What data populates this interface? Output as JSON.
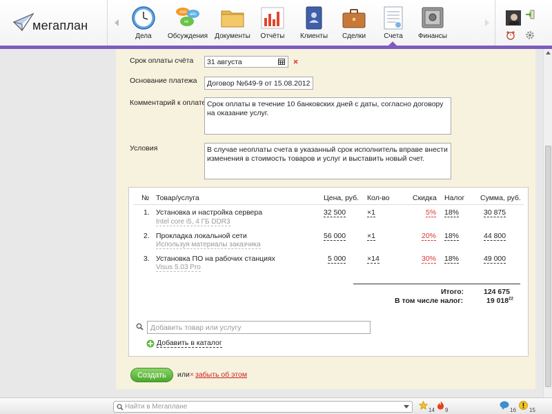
{
  "app": {
    "logo_text": "мегаплан"
  },
  "nav": [
    {
      "key": "tasks",
      "label": "Дела",
      "icon": "clock-icon"
    },
    {
      "key": "discussions",
      "label": "Обсуждения",
      "icon": "speech-bubbles-icon",
      "bubble_texts": [
        "лол",
        "айс",
        "ок"
      ]
    },
    {
      "key": "documents",
      "label": "Документы",
      "icon": "folder-icon"
    },
    {
      "key": "reports",
      "label": "Отчёты",
      "icon": "bar-chart-icon"
    },
    {
      "key": "clients",
      "label": "Клиенты",
      "icon": "contacts-book-icon"
    },
    {
      "key": "deals",
      "label": "Сделки",
      "icon": "briefcase-icon"
    },
    {
      "key": "invoices",
      "label": "Счета",
      "icon": "invoice-icon",
      "active": true
    },
    {
      "key": "finances",
      "label": "Финансы",
      "icon": "safe-icon"
    }
  ],
  "form": {
    "due_date": {
      "label": "Срок оплаты счёта",
      "value": "31 августа"
    },
    "basis": {
      "label": "Основание платежа",
      "value": "Договор №649-9 от 15.08.2012"
    },
    "comment": {
      "label": "Комментарий к оплате",
      "value": "Срок оплаты в течение 10 банковских дней с даты, согласно договору на оказание услуг."
    },
    "terms": {
      "label": "Условия",
      "value": "В случае неоплаты счета в указанный срок исполнитель вправе внести изменения в стоимость товаров и услуг и выставить новый счет."
    }
  },
  "table": {
    "headers": {
      "num": "№",
      "item": "Товар/услуга",
      "price": "Цена, руб.",
      "qty": "Кол-во",
      "discount": "Скидка",
      "tax": "Налог",
      "sum": "Сумма, руб."
    },
    "rows": [
      {
        "num": "1.",
        "name": "Установка и настройка сервера",
        "sub": "Intel core i5, 4 ГБ DDR3",
        "price": "32 500",
        "qty": "×1",
        "discount": "5%",
        "tax": "18%",
        "sum": "30 875"
      },
      {
        "num": "2.",
        "name": "Прокладка локальной сети",
        "sub": "Используя материалы заказчика",
        "price": "56 000",
        "qty": "×1",
        "discount": "20%",
        "tax": "18%",
        "sum": "44 800"
      },
      {
        "num": "3.",
        "name": "Установка ПО на рабочих станциях",
        "sub": "Visus 5.03 Pro",
        "price": "5 000",
        "qty": "×14",
        "discount": "30%",
        "tax": "18%",
        "sum": "49 000"
      }
    ],
    "total_label": "Итого:",
    "total_value": "124 675",
    "tax_label": "В том числе налог:",
    "tax_value": "19 018",
    "tax_value_kopecks": "22",
    "add_placeholder": "Добавить товар или услугу",
    "add_to_catalog": "Добавить в каталог"
  },
  "actions": {
    "create": "Создать",
    "or": "или",
    "forget_mark": "×",
    "forget": "забыть об этом"
  },
  "footer": {
    "search_placeholder": "Найти в Мегаплане",
    "star_count": "14",
    "fire_count": "9",
    "chat_count": "16",
    "alert_count": "15"
  },
  "colors": {
    "accent": "#7e5bbd",
    "content_bg": "#f7f2de",
    "create_button": "#5cb83a",
    "discount": "#dd3333"
  }
}
